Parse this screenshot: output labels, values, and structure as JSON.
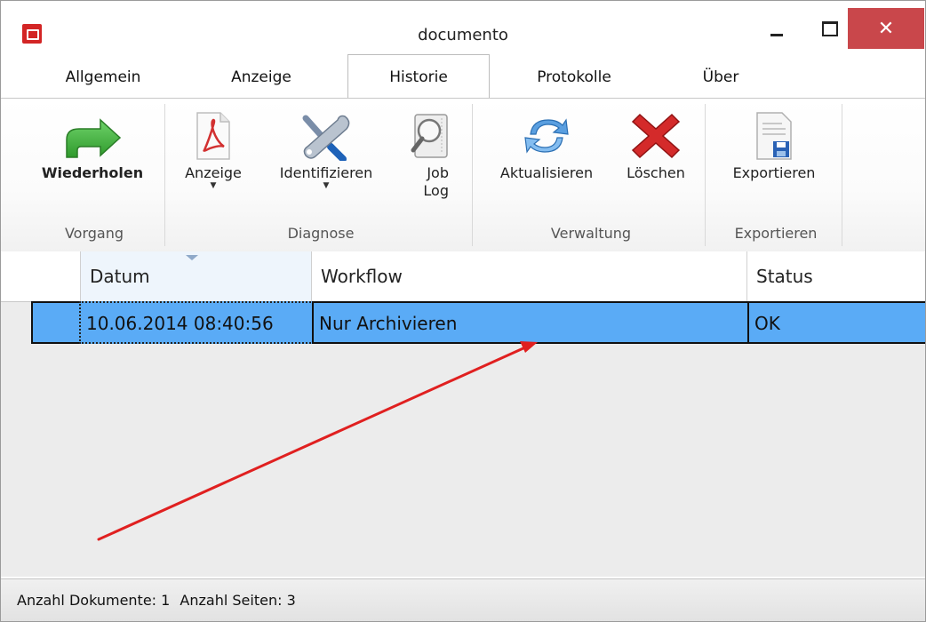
{
  "window": {
    "title": "documento"
  },
  "tabs": [
    {
      "label": "Allgemein"
    },
    {
      "label": "Anzeige"
    },
    {
      "label": "Historie"
    },
    {
      "label": "Protokolle"
    },
    {
      "label": "Über"
    }
  ],
  "active_tab": "Historie",
  "ribbon": {
    "groups": {
      "vorgang": "Vorgang",
      "diagnose": "Diagnose",
      "verwaltung": "Verwaltung",
      "exportieren": "Exportieren"
    },
    "buttons": {
      "wiederholen": "Wiederholen",
      "anzeige": "Anzeige",
      "identifizieren": "Identifizieren",
      "joblog_line1": "Job",
      "joblog_line2": "Log",
      "aktualisieren": "Aktualisieren",
      "loeschen": "Löschen",
      "exportieren": "Exportieren"
    },
    "icons": {
      "wiederholen": "green-redo-arrow-icon",
      "anzeige": "pdf-document-icon",
      "identifizieren": "wrench-screwdriver-icon",
      "joblog": "magnifier-log-icon",
      "aktualisieren": "refresh-arrows-icon",
      "loeschen": "red-x-delete-icon",
      "exportieren": "document-save-icon"
    }
  },
  "grid": {
    "columns": [
      "Datum",
      "Workflow",
      "Status"
    ],
    "rows": [
      {
        "datum": "10.06.2014 08:40:56",
        "workflow": "Nur Archivieren",
        "status": "OK"
      }
    ],
    "selection_color": "#5aabf6"
  },
  "status": {
    "documents": "Anzahl Dokumente: 1",
    "pages": "Anzahl Seiten: 3"
  },
  "colors": {
    "close_button": "#c9474b",
    "annotation_arrow": "#e02020"
  }
}
